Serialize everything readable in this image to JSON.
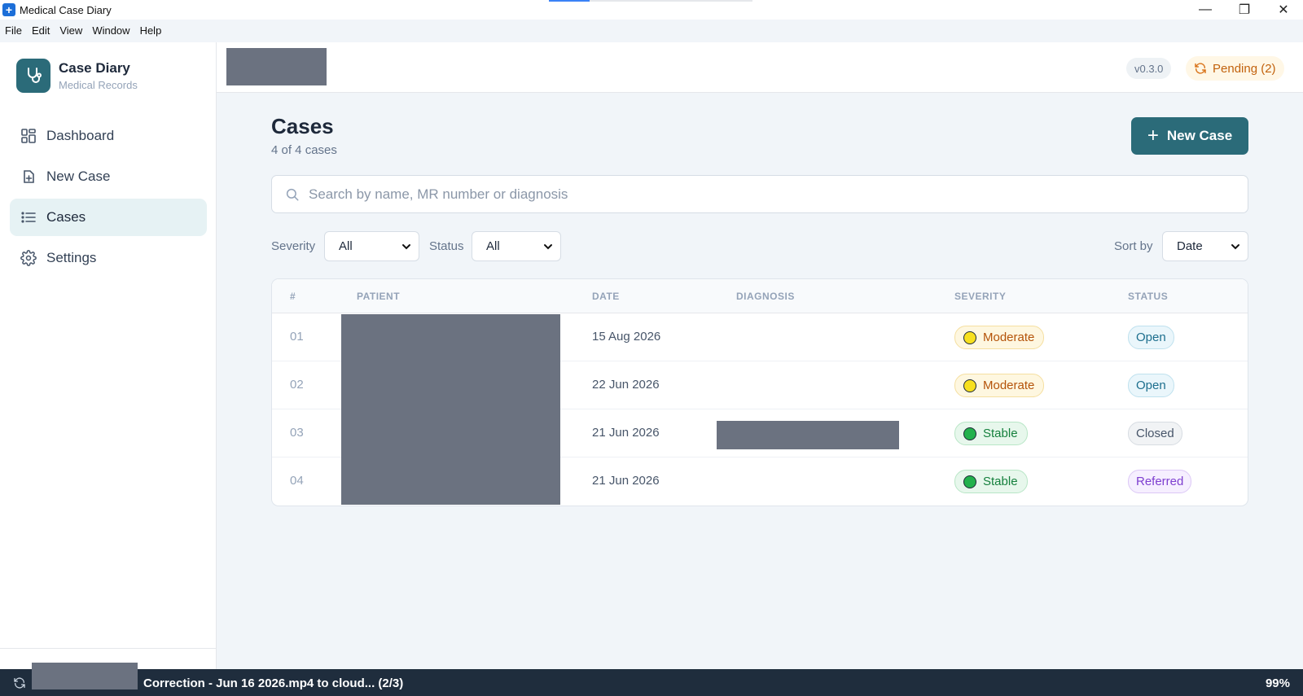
{
  "window": {
    "title": "Medical Case Diary",
    "progress_fraction": 0.2,
    "controls": {
      "minimize": "—",
      "maximize": "❐",
      "close": "✕"
    }
  },
  "menu": [
    "File",
    "Edit",
    "View",
    "Window",
    "Help"
  ],
  "brand": {
    "title": "Case Diary",
    "subtitle": "Medical Records"
  },
  "nav": [
    {
      "label": "Dashboard",
      "icon": "grid-icon"
    },
    {
      "label": "New Case",
      "icon": "add-file-icon"
    },
    {
      "label": "Cases",
      "icon": "list-icon",
      "active": true
    },
    {
      "label": "Settings",
      "icon": "gear-icon"
    }
  ],
  "header": {
    "version": "v0.3.0",
    "pending": "Pending (2)"
  },
  "page": {
    "title": "Cases",
    "count": "4 of 4 cases",
    "new_case_label": "New Case"
  },
  "search": {
    "placeholder": "Search by name, MR number or diagnosis"
  },
  "filters": {
    "severity_label": "Severity",
    "severity_value": "All",
    "status_label": "Status",
    "status_value": "All",
    "sort_label": "Sort by",
    "sort_value": "Date"
  },
  "table": {
    "columns": [
      "#",
      "PATIENT",
      "DATE",
      "DIAGNOSIS",
      "SEVERITY",
      "STATUS"
    ],
    "rows": [
      {
        "num": "01",
        "date": "15 Aug 2026",
        "severity": "Moderate",
        "status": "Open"
      },
      {
        "num": "02",
        "date": "22 Jun 2026",
        "severity": "Moderate",
        "status": "Open"
      },
      {
        "num": "03",
        "date": "21 Jun 2026",
        "severity": "Stable",
        "status": "Closed"
      },
      {
        "num": "04",
        "date": "21 Jun 2026",
        "severity": "Stable",
        "status": "Referred"
      }
    ]
  },
  "statusbar": {
    "text": "Correction - Jun 16 2026.mp4 to cloud... (2/3)",
    "percent": "99%"
  },
  "colors": {
    "accent": "#2b6b79",
    "moderate": "#f7e01e",
    "stable": "#22b14c",
    "redaction": "#6b7280"
  }
}
